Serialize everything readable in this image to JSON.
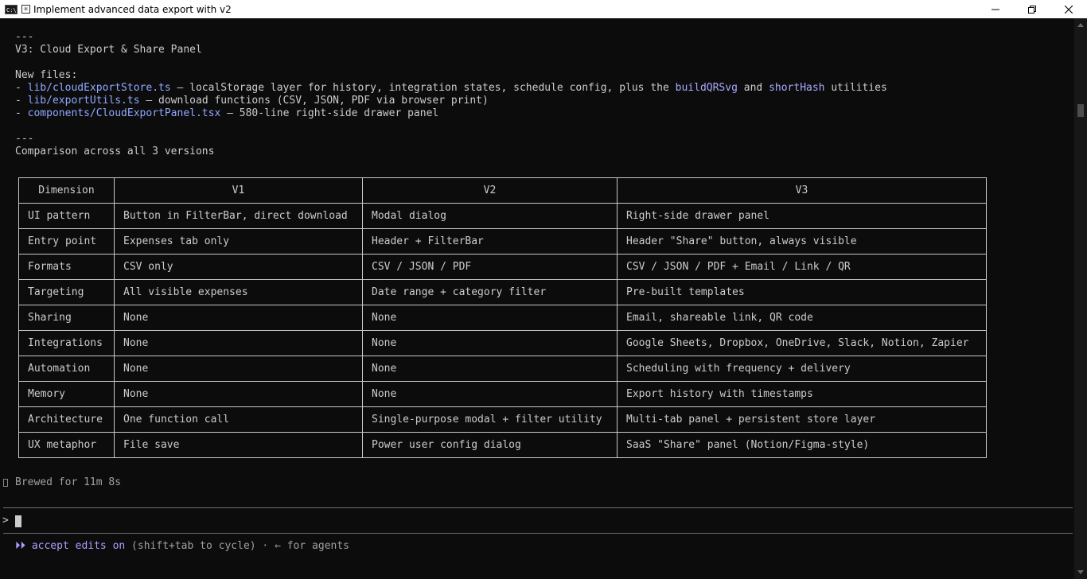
{
  "window": {
    "title": "Implement advanced data export with v2",
    "app_icon_text": "C:\\"
  },
  "intro": {
    "sep1": "---",
    "heading": "V3: Cloud Export & Share Panel",
    "new_files_label": "New files:",
    "files": [
      {
        "prefix": "- ",
        "path": "lib/cloudExportStore.ts",
        "desc_before": " — localStorage layer for history, integration states, schedule config, plus the ",
        "code1": "buildQRSvg",
        "mid": " and ",
        "code2": "shortHash",
        "desc_after": " utilities"
      },
      {
        "prefix": "- ",
        "path": "lib/exportUtils.ts",
        "desc": " — download functions (CSV, JSON, PDF via browser print)"
      },
      {
        "prefix": "- ",
        "path": "components/CloudExportPanel.tsx",
        "desc": " — 580-line right-side drawer panel"
      }
    ],
    "sep2": "---",
    "comparison_title": "Comparison across all 3 versions"
  },
  "table": {
    "headers": [
      "Dimension",
      "V1",
      "V2",
      "V3"
    ],
    "rows": [
      [
        "UI pattern",
        "Button in FilterBar, direct download",
        "Modal dialog",
        "Right-side drawer panel"
      ],
      [
        "Entry point",
        "Expenses tab only",
        "Header + FilterBar",
        "Header \"Share\" button, always visible"
      ],
      [
        "Formats",
        "CSV only",
        "CSV / JSON / PDF",
        "CSV / JSON / PDF + Email / Link / QR"
      ],
      [
        "Targeting",
        "All visible expenses",
        "Date range + category filter",
        "Pre-built templates"
      ],
      [
        "Sharing",
        "None",
        "None",
        "Email, shareable link, QR code"
      ],
      [
        "Integrations",
        "None",
        "None",
        "Google Sheets, Dropbox, OneDrive, Slack, Notion, Zapier"
      ],
      [
        "Automation",
        "None",
        "None",
        "Scheduling with frequency + delivery"
      ],
      [
        "Memory",
        "None",
        "None",
        "Export history with timestamps"
      ],
      [
        "Architecture",
        "One function call",
        "Single-purpose modal + filter utility",
        "Multi-tab panel + persistent store layer"
      ],
      [
        "UX metaphor",
        "File save",
        "Power user config dialog",
        "SaaS \"Share\" panel (Notion/Figma-style)"
      ]
    ]
  },
  "footer": {
    "brewed": "Brewed for 11m 8s",
    "prompt_symbol": ">",
    "status_icon": "⏵⏵",
    "status_accent": "accept edits on",
    "status_rest": " (shift+tab to cycle) · ← for agents"
  },
  "colors": {
    "background": "#0c0c0c",
    "text": "#cccccc",
    "link": "#8fa8ff",
    "accent": "#b19cff"
  },
  "icons": {
    "minimize": "minimize-icon",
    "restore": "restore-icon",
    "close": "close-icon"
  }
}
